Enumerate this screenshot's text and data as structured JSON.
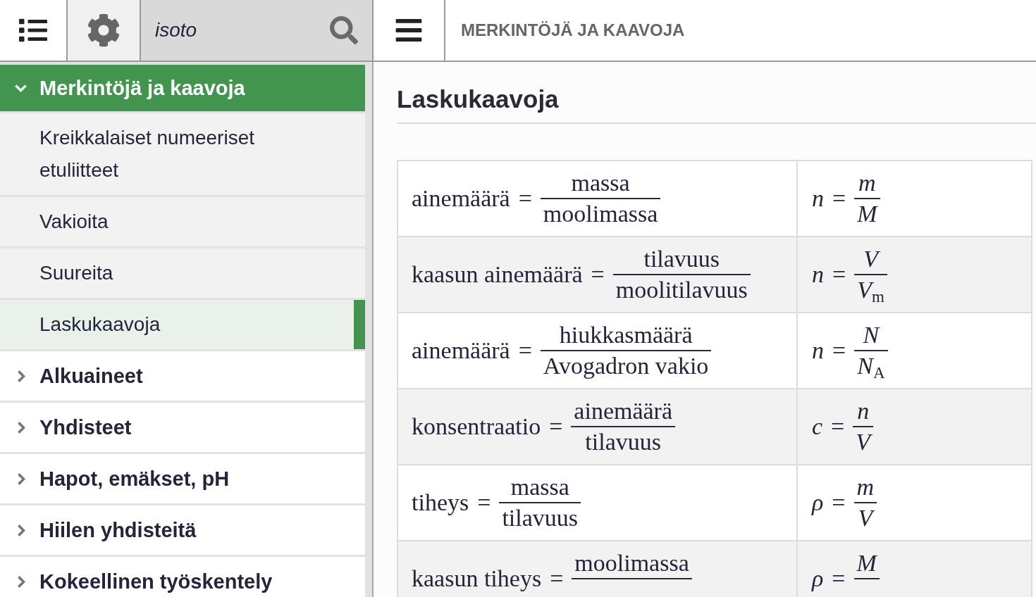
{
  "toolbar": {
    "search": {
      "value": "isoto"
    },
    "title": "MERKINTÖJÄ JA KAAVOJA"
  },
  "sidebar": {
    "items": [
      {
        "label": "Merkintöjä ja kaavoja",
        "expanded": true,
        "children": [
          {
            "label": "Kreikkalaiset numeeriset etuliitteet",
            "selected": false
          },
          {
            "label": "Vakioita",
            "selected": false
          },
          {
            "label": "Suureita",
            "selected": false
          },
          {
            "label": "Laskukaavoja",
            "selected": true
          }
        ]
      },
      {
        "label": "Alkuaineet",
        "expanded": false
      },
      {
        "label": "Yhdisteet",
        "expanded": false
      },
      {
        "label": "Hapot, emäkset, pH",
        "expanded": false
      },
      {
        "label": "Hiilen yhdisteitä",
        "expanded": false
      },
      {
        "label": "Kokeellinen työskentely",
        "expanded": false
      }
    ]
  },
  "main": {
    "heading": "Laskukaavoja",
    "formulas": [
      {
        "word": {
          "term": "ainemäärä",
          "op": "=",
          "numerator": "massa",
          "denominator": "moolimassa"
        },
        "symbol": {
          "term": "n",
          "op": "=",
          "numerator": "m",
          "denominator": "M"
        }
      },
      {
        "word": {
          "term": "kaasun ainemäärä",
          "op": "=",
          "numerator": "tilavuus",
          "denominator": "moolitilavuus"
        },
        "symbol": {
          "term": "n",
          "op": "=",
          "numerator": "V",
          "denominator": "V$_{m}$"
        }
      },
      {
        "word": {
          "term": "ainemäärä",
          "op": "=",
          "numerator": "hiukkasmäärä",
          "denominator": "Avogadron vakio"
        },
        "symbol": {
          "term": "n",
          "op": "=",
          "numerator": "N",
          "denominator": "N$_{A}$"
        }
      },
      {
        "word": {
          "term": "konsentraatio",
          "op": "=",
          "numerator": "ainemäärä",
          "denominator": "tilavuus"
        },
        "symbol": {
          "term": "c",
          "op": "=",
          "numerator": "n",
          "denominator": "V"
        }
      },
      {
        "word": {
          "term": "tiheys",
          "op": "=",
          "numerator": "massa",
          "denominator": "tilavuus"
        },
        "symbol": {
          "term": "ρ",
          "op": "=",
          "numerator": "m",
          "denominator": "V"
        }
      },
      {
        "word": {
          "term": "kaasun tiheys",
          "op": "=",
          "numerator": "moolimassa"
        },
        "symbol": {
          "term": "ρ",
          "op": "=",
          "numerator": "M"
        }
      }
    ]
  }
}
